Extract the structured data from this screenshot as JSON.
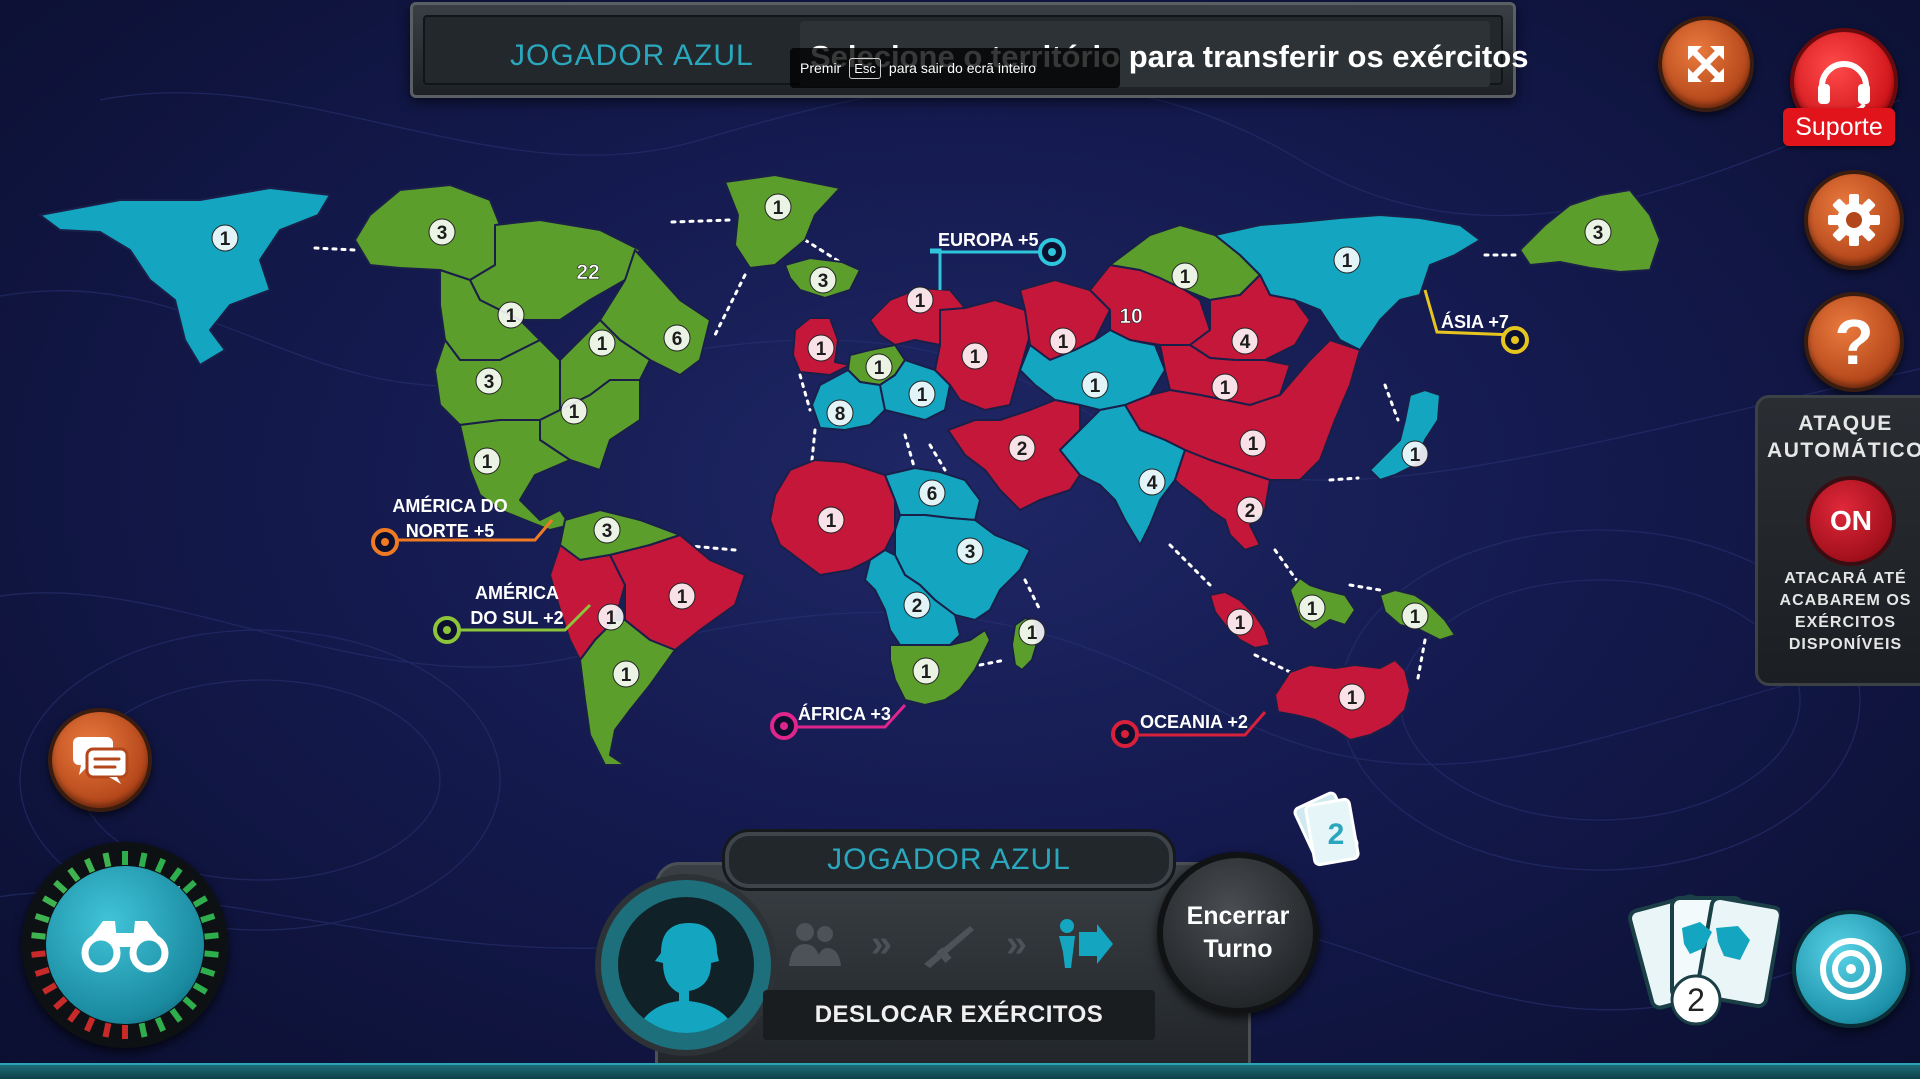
{
  "banner": {
    "player": "JOGADOR AZUL",
    "message": "Selecione o território para transferir os exércitos",
    "esc_hint_pre": "Premir",
    "esc_key": "Esc",
    "esc_hint_post": "para sair do ecrã inteiro"
  },
  "support": {
    "label": "Suporte"
  },
  "auto_attack": {
    "title": "ATAQUE AUTOMÁTICO",
    "toggle": "ON",
    "description": "ATACARÁ ATÉ ACABAREM OS EXÉRCITOS DISPONÍVEIS"
  },
  "continents": [
    {
      "name": "EUROPA +5",
      "color": "#2fc5dc"
    },
    {
      "name": "ÁSIA +7",
      "color": "#e7c51f"
    },
    {
      "name": "AMÉRICA DO NORTE +5",
      "color": "#f07a24"
    },
    {
      "name": "AMÉRICA DO SUL +2",
      "color": "#8cc43a"
    },
    {
      "name": "ÁFRICA +3",
      "color": "#e0258d"
    },
    {
      "name": "OCEANIA +2",
      "color": "#d8203a"
    }
  ],
  "player_colors": {
    "blue": "#14a6c0",
    "green": "#5c9e2c",
    "red": "#c5173a"
  },
  "territories": [
    {
      "id": "alaska",
      "owner": "blue",
      "armies": "1"
    },
    {
      "id": "northwest",
      "owner": "green",
      "armies": "3"
    },
    {
      "id": "greenland",
      "owner": "green",
      "armies": "1"
    },
    {
      "id": "alberta",
      "owner": "green",
      "armies": "1"
    },
    {
      "id": "ontario",
      "owner": "green",
      "armies": "22"
    },
    {
      "id": "quebec",
      "owner": "green",
      "armies": "6"
    },
    {
      "id": "western-us",
      "owner": "green",
      "armies": "3"
    },
    {
      "id": "eastern-us",
      "owner": "green",
      "armies": "1"
    },
    {
      "id": "central-us",
      "owner": "green",
      "armies": "1"
    },
    {
      "id": "central-america",
      "owner": "green",
      "armies": "1"
    },
    {
      "id": "venezuela",
      "owner": "green",
      "armies": "3"
    },
    {
      "id": "peru",
      "owner": "red",
      "armies": "1"
    },
    {
      "id": "brazil",
      "owner": "red",
      "armies": "1"
    },
    {
      "id": "argentina",
      "owner": "green",
      "armies": "1"
    },
    {
      "id": "iceland",
      "owner": "green",
      "armies": "3"
    },
    {
      "id": "great-britain",
      "owner": "red",
      "armies": "1"
    },
    {
      "id": "scandinavia",
      "owner": "red",
      "armies": "1"
    },
    {
      "id": "northern-europe",
      "owner": "green",
      "armies": "1"
    },
    {
      "id": "western-europe",
      "owner": "blue",
      "armies": "8"
    },
    {
      "id": "southern-europe",
      "owner": "blue",
      "armies": "1"
    },
    {
      "id": "ukraine",
      "owner": "red",
      "armies": "1"
    },
    {
      "id": "ural",
      "owner": "red",
      "armies": "1"
    },
    {
      "id": "siberia",
      "owner": "red",
      "armies": "10"
    },
    {
      "id": "yakutsk",
      "owner": "green",
      "armies": "1"
    },
    {
      "id": "kamchatka",
      "owner": "blue",
      "armies": "1"
    },
    {
      "id": "irkutsk",
      "owner": "red",
      "armies": "4"
    },
    {
      "id": "afghanistan",
      "owner": "blue",
      "armies": "1"
    },
    {
      "id": "mongolia",
      "owner": "red",
      "armies": "1"
    },
    {
      "id": "japan",
      "owner": "blue",
      "armies": "1"
    },
    {
      "id": "china",
      "owner": "red",
      "armies": "1"
    },
    {
      "id": "middle-east",
      "owner": "red",
      "armies": "2"
    },
    {
      "id": "india",
      "owner": "blue",
      "armies": "4"
    },
    {
      "id": "siam",
      "owner": "red",
      "armies": "2"
    },
    {
      "id": "north-africa",
      "owner": "red",
      "armies": "1"
    },
    {
      "id": "egypt",
      "owner": "blue",
      "armies": "6"
    },
    {
      "id": "east-africa",
      "owner": "blue",
      "armies": "3"
    },
    {
      "id": "congo",
      "owner": "blue",
      "armies": "2"
    },
    {
      "id": "south-africa",
      "owner": "green",
      "armies": "1"
    },
    {
      "id": "madagascar",
      "owner": "green",
      "armies": "1"
    },
    {
      "id": "indonesia",
      "owner": "red",
      "armies": "1"
    },
    {
      "id": "new-guinea",
      "owner": "green",
      "armies": "1"
    },
    {
      "id": "papua",
      "owner": "green",
      "armies": "1"
    },
    {
      "id": "western-australia",
      "owner": "red",
      "armies": "1"
    },
    {
      "id": "far-east",
      "owner": "green",
      "armies": "3"
    }
  ],
  "turn": {
    "player": "JOGADOR AZUL",
    "phase": "DESLOCAR EXÉRCITOS",
    "end_turn": "Encerrar Turno",
    "cards_count_small": "2",
    "cards_count": "2",
    "phase_icons": [
      "reinforce-icon",
      "attack-icon",
      "move-icon"
    ]
  }
}
